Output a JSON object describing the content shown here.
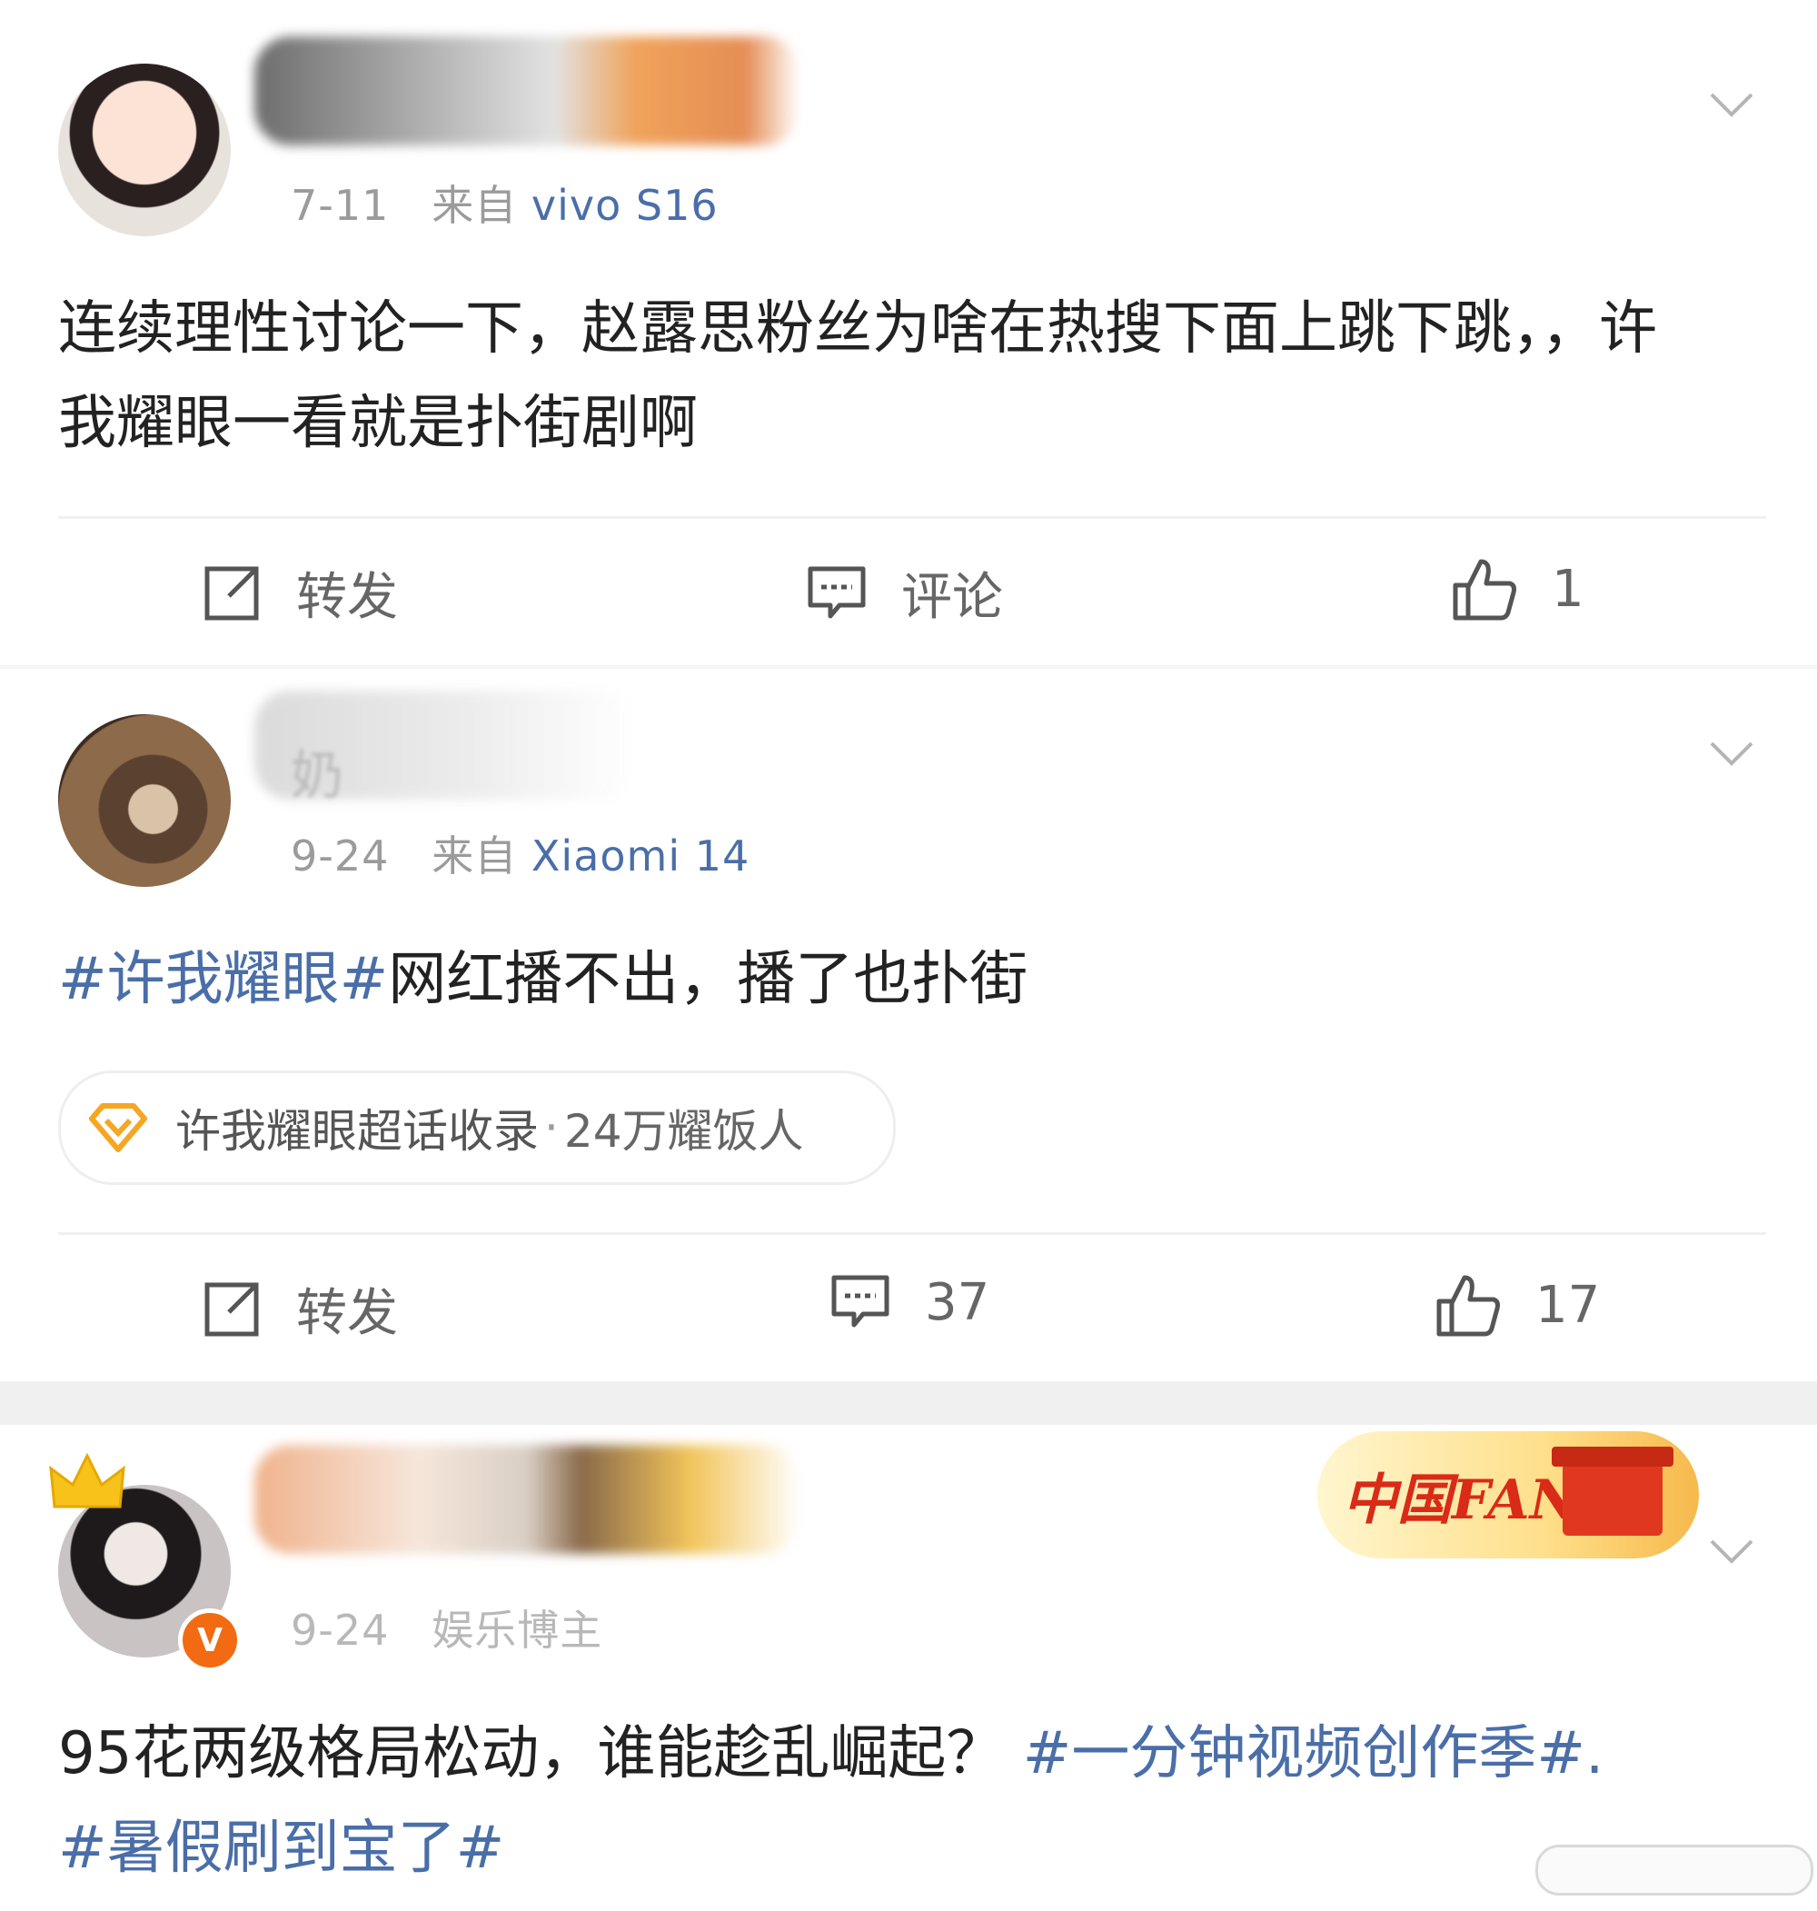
{
  "posts": [
    {
      "date": "7-11",
      "from_label": "来自",
      "source": "vivo S16",
      "text": "连续理性讨论一下，赵露思粉丝为啥在热搜下面上跳下跳，，许我耀眼一看就是扑街剧啊",
      "actions": {
        "repost": "转发",
        "comment": "评论",
        "like": "1"
      }
    },
    {
      "name_char": "奶",
      "date": "9-24",
      "from_label": "来自",
      "source": "Xiaomi 14",
      "hashtag": "#许我耀眼#",
      "text": "网红播不出，播了也扑街",
      "super_topic": "许我耀眼超话收录",
      "super_topic_sep": "·",
      "super_topic_fans": "24万耀饭人",
      "actions": {
        "repost": "转发",
        "comment": "37",
        "like": "17"
      }
    },
    {
      "date": "9-24",
      "category": "娱乐博主",
      "verified_badge": "V",
      "badge_text": "中国FANS",
      "text": "95花两级格局松动，谁能趁乱崛起？",
      "hashtag1": "#一分钟视频创作季#.",
      "hashtag2": "#暑假刷到宝了#"
    }
  ],
  "colors": {
    "link": "#4a6ea8",
    "meta": "#9b9b9b",
    "text": "#222222",
    "accent": "#f26b12"
  },
  "icons": [
    "chevron-down-icon",
    "repost-icon",
    "comment-icon",
    "like-icon",
    "super-topic-diamond-icon",
    "crown-icon"
  ]
}
